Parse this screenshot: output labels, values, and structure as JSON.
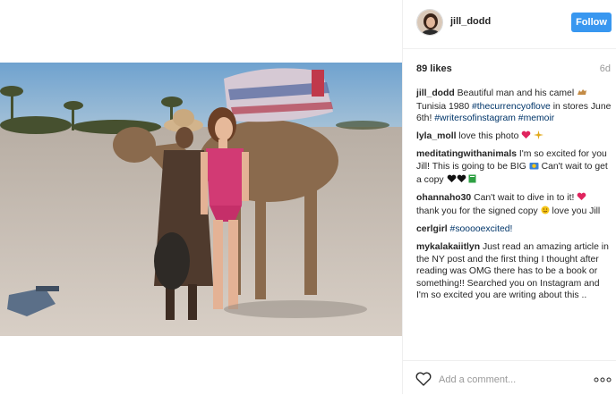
{
  "post": {
    "username": "jill_dodd",
    "follow_label": "Follow",
    "likes": "89 likes",
    "age": "6d"
  },
  "caption": {
    "user": "jill_dodd",
    "text_1": "Beautiful man and his camel",
    "text_2": "Tunisia 1980",
    "tag_1": "#thecurrencyoflove",
    "text_3": "in stores June 6th!",
    "tag_2": "#writersofinstagram",
    "tag_3": "#memoir"
  },
  "comments": [
    {
      "user": "lyla_moll",
      "text": "love this photo"
    },
    {
      "user": "meditatingwithanimals",
      "text": "I'm so excited for you Jill! This is going to be BIG",
      "text_after": "Can't wait to get a copy"
    },
    {
      "user": "ohannaho30",
      "text": "Can't wait to dive in to it!",
      "text_2": "thank you for the signed copy",
      "text_3": "love you Jill"
    },
    {
      "user": "cerlgirl",
      "tag": "#sooooexcited!"
    },
    {
      "user": "mykalakaiitlyn",
      "text": "Just read an amazing article in the NY post and the first thing I thought after reading was OMG there has to be a book or something!! Searched you on Instagram and I'm so excited you are writing about this .."
    }
  ],
  "footer": {
    "placeholder": "Add a comment..."
  },
  "colors": {
    "accent": "#3897f0",
    "hashtag": "#003569",
    "muted": "#999999"
  },
  "icons": [
    "camel-emoji-icon",
    "heart-emoji-icon",
    "sparkle-emoji-icon",
    "heart-outline-icon",
    "more-options-icon"
  ]
}
